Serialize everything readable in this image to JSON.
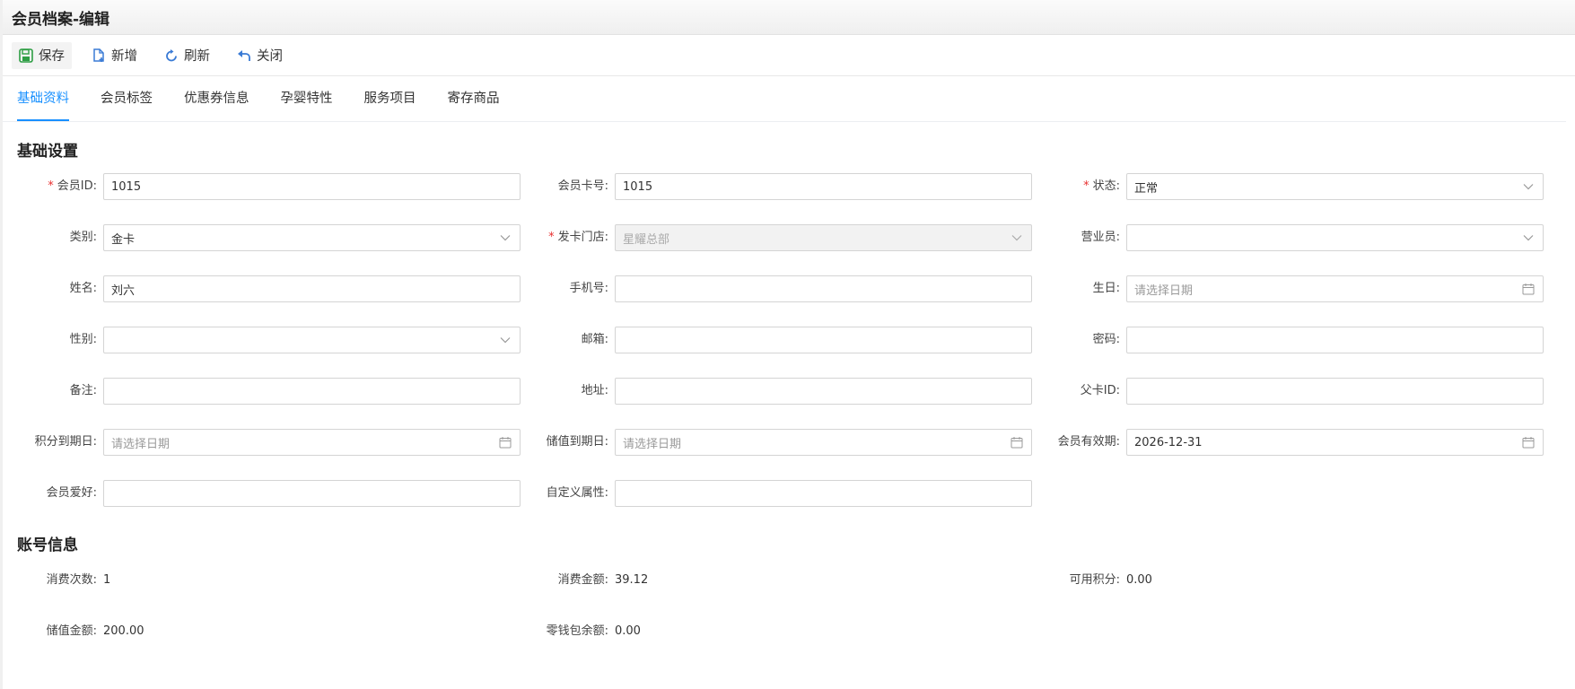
{
  "window": {
    "title": "会员档案-编辑"
  },
  "toolbar": {
    "save": "保存",
    "add": "新增",
    "refresh": "刷新",
    "close": "关闭"
  },
  "tabs": [
    "基础资料",
    "会员标签",
    "优惠券信息",
    "孕婴特性",
    "服务项目",
    "寄存商品"
  ],
  "basic": {
    "title": "基础设置",
    "member_id": {
      "label": "会员ID:",
      "value": "1015"
    },
    "card_no": {
      "label": "会员卡号:",
      "value": "1015"
    },
    "status": {
      "label": "状态:",
      "value": "正常"
    },
    "category": {
      "label": "类别:",
      "value": "金卡"
    },
    "store": {
      "label": "发卡门店:",
      "value": "星耀总部"
    },
    "salesman": {
      "label": "营业员:",
      "value": ""
    },
    "name": {
      "label": "姓名:",
      "value": "刘六"
    },
    "phone": {
      "label": "手机号:",
      "value": ""
    },
    "birthday": {
      "label": "生日:",
      "placeholder": "请选择日期"
    },
    "gender": {
      "label": "性别:",
      "value": ""
    },
    "email": {
      "label": "邮箱:",
      "value": ""
    },
    "password": {
      "label": "密码:",
      "value": ""
    },
    "remark": {
      "label": "备注:",
      "value": ""
    },
    "address": {
      "label": "地址:",
      "value": ""
    },
    "parent_card": {
      "label": "父卡ID:",
      "value": ""
    },
    "points_expire": {
      "label": "积分到期日:",
      "placeholder": "请选择日期"
    },
    "stored_expire": {
      "label": "储值到期日:",
      "placeholder": "请选择日期"
    },
    "valid_until": {
      "label": "会员有效期:",
      "value": "2026-12-31"
    },
    "hobby": {
      "label": "会员爱好:",
      "value": ""
    },
    "custom_attr": {
      "label": "自定义属性:",
      "value": ""
    }
  },
  "account": {
    "title": "账号信息",
    "consume_count": {
      "label": "消费次数:",
      "value": "1"
    },
    "consume_amount": {
      "label": "消费金额:",
      "value": "39.12"
    },
    "available_points": {
      "label": "可用积分:",
      "value": "0.00"
    },
    "stored_amount": {
      "label": "储值金额:",
      "value": "200.00"
    },
    "wallet_balance": {
      "label": "零钱包余额:",
      "value": "0.00"
    }
  },
  "colors": {
    "accent": "#1890ff",
    "required": "#e83030",
    "save_icon": "#2e9e44"
  }
}
